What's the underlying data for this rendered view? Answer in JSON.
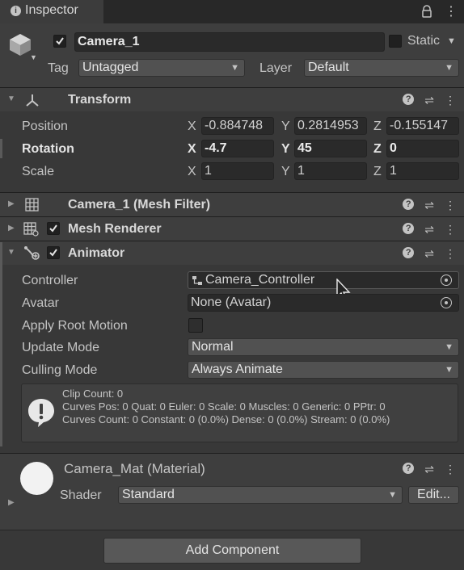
{
  "window": {
    "tab_title": "Inspector"
  },
  "object": {
    "name": "Camera_1",
    "active": true,
    "static_label": "Static",
    "tag_label": "Tag",
    "tag_value": "Untagged",
    "layer_label": "Layer",
    "layer_value": "Default"
  },
  "transform": {
    "title": "Transform",
    "position": {
      "label": "Position",
      "x": "-0.884748",
      "y": "0.2814953",
      "z": "-0.155147"
    },
    "rotation": {
      "label": "Rotation",
      "x": "-4.7",
      "y": "45",
      "z": "0"
    },
    "scale": {
      "label": "Scale",
      "x": "1",
      "y": "1",
      "z": "1"
    },
    "axis_x": "X",
    "axis_y": "Y",
    "axis_z": "Z"
  },
  "mesh_filter": {
    "title": "Camera_1 (Mesh Filter)"
  },
  "mesh_renderer": {
    "title": "Mesh Renderer",
    "enabled": true
  },
  "animator": {
    "title": "Animator",
    "enabled": true,
    "controller_label": "Controller",
    "controller_value": "Camera_Controller",
    "avatar_label": "Avatar",
    "avatar_value": "None (Avatar)",
    "apply_root_motion_label": "Apply Root Motion",
    "apply_root_motion": false,
    "update_mode_label": "Update Mode",
    "update_mode_value": "Normal",
    "culling_mode_label": "Culling Mode",
    "culling_mode_value": "Always Animate",
    "info_line1": "Clip Count: 0",
    "info_line2": "Curves Pos: 0 Quat: 0 Euler: 0 Scale: 0 Muscles: 0 Generic: 0 PPtr: 0",
    "info_line3": "Curves Count: 0 Constant: 0 (0.0%) Dense: 0 (0.0%) Stream: 0 (0.0%)"
  },
  "material": {
    "title": "Camera_Mat (Material)",
    "shader_label": "Shader",
    "shader_value": "Standard",
    "edit_label": "Edit..."
  },
  "footer": {
    "add_component_label": "Add Component"
  }
}
